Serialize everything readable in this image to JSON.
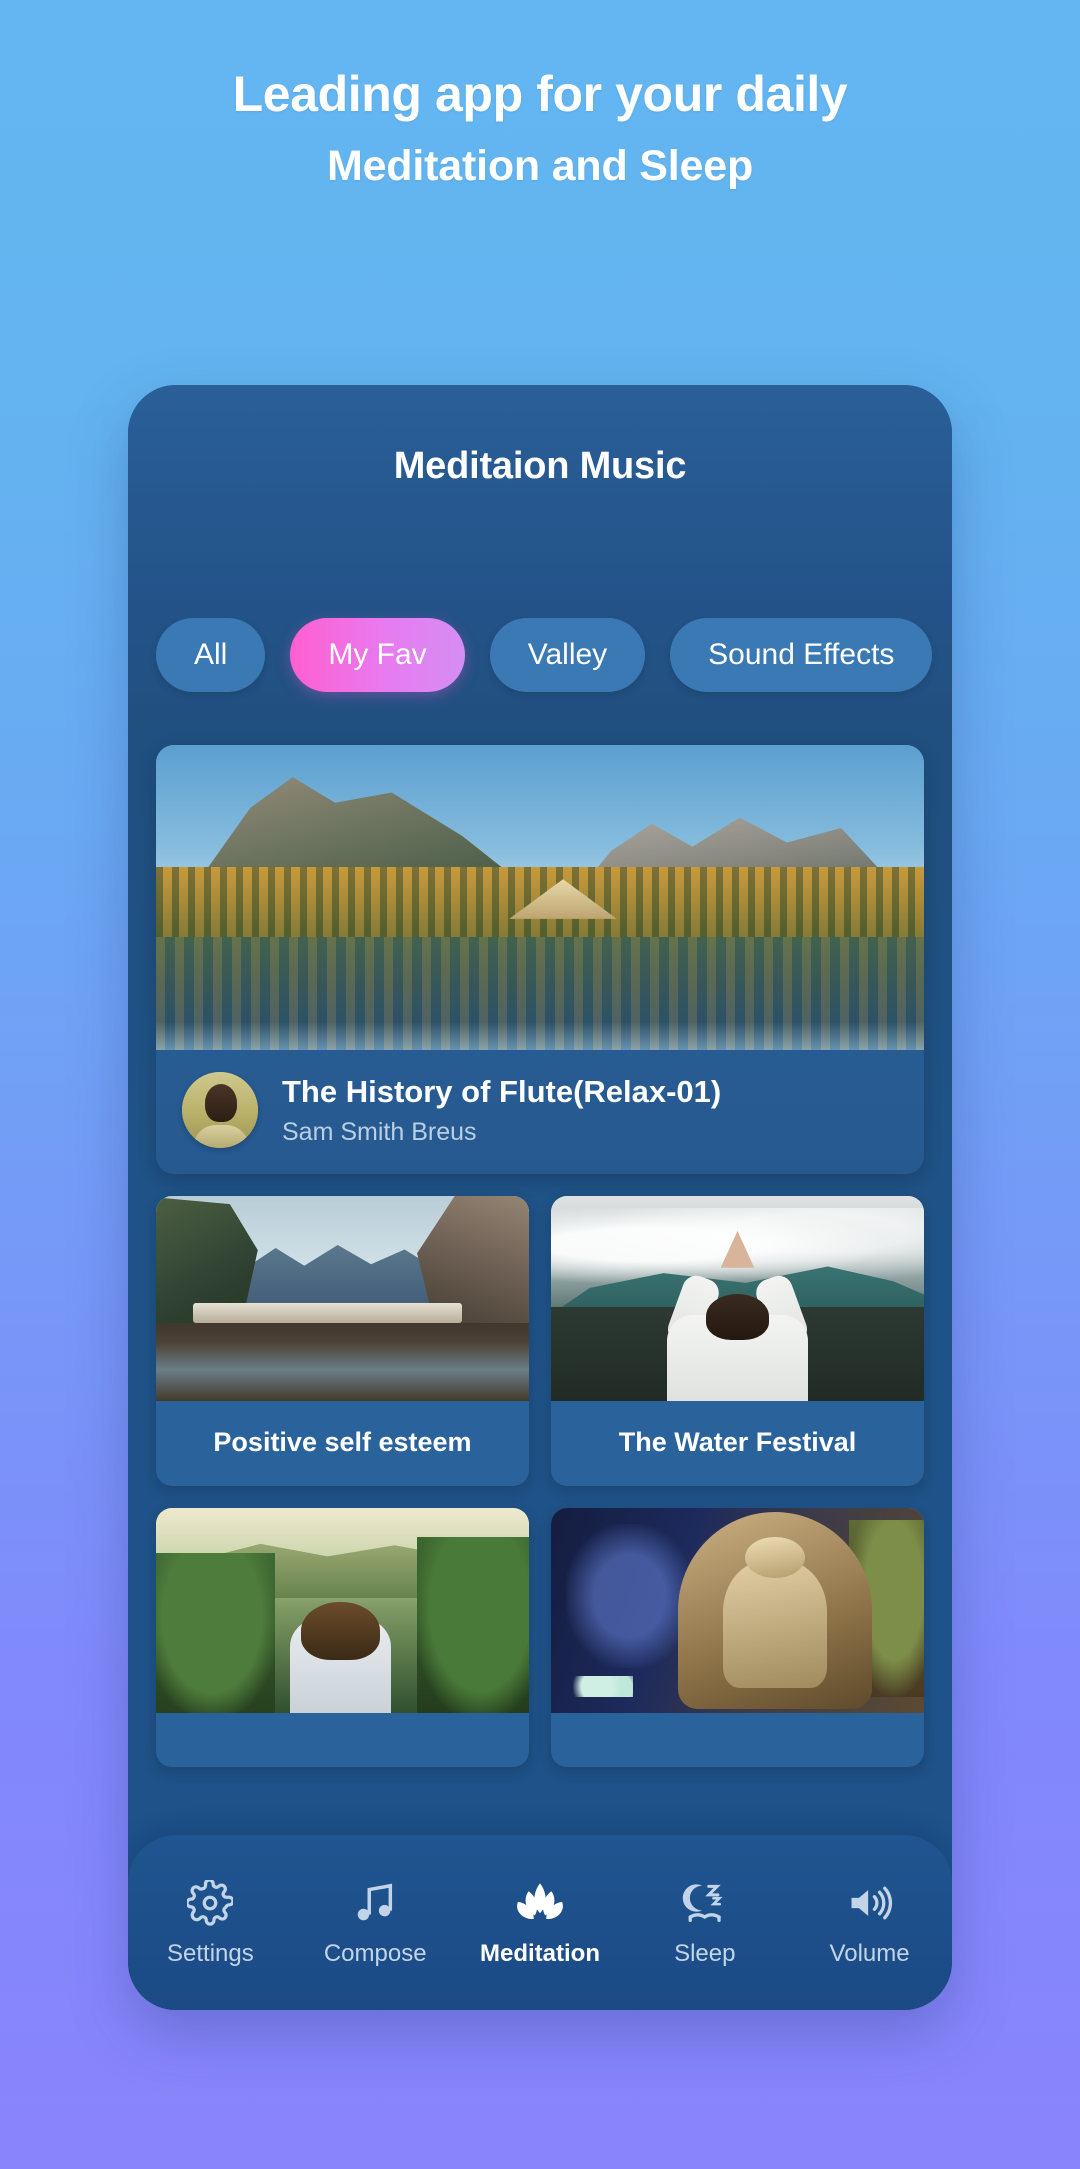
{
  "hero": {
    "line1": "Leading app for your daily",
    "line2": "Meditation and Sleep"
  },
  "app": {
    "title": "Meditaion Music",
    "accent_pink": "#ff5fd0",
    "panel_blue": "#1f5792",
    "chips": [
      {
        "label": "All",
        "active": false
      },
      {
        "label": "My Fav",
        "active": true
      },
      {
        "label": "Valley",
        "active": false
      },
      {
        "label": "Sound Effects",
        "active": false
      }
    ],
    "featured": {
      "title": "The History of Flute(Relax-01)",
      "artist": "Sam Smith Breus",
      "image_name": "alpine-lake-autumn-forest",
      "avatar_name": "artist-avatar"
    },
    "cards": [
      {
        "title": "Positive self esteem",
        "image_name": "karst-lagoon-village"
      },
      {
        "title": "The Water Festival",
        "image_name": "woman-yoga-misty-mountains"
      },
      {
        "title": "",
        "image_name": "woman-overlooking-green-valley"
      },
      {
        "title": "",
        "image_name": "buddha-statue-garden"
      }
    ],
    "nav": [
      {
        "label": "Settings",
        "icon": "gear-icon",
        "active": false
      },
      {
        "label": "Compose",
        "icon": "music-note-icon",
        "active": false
      },
      {
        "label": "Meditation",
        "icon": "lotus-icon",
        "active": true
      },
      {
        "label": "Sleep",
        "icon": "moon-sleep-icon",
        "active": false
      },
      {
        "label": "Volume",
        "icon": "speaker-icon",
        "active": false
      }
    ]
  }
}
